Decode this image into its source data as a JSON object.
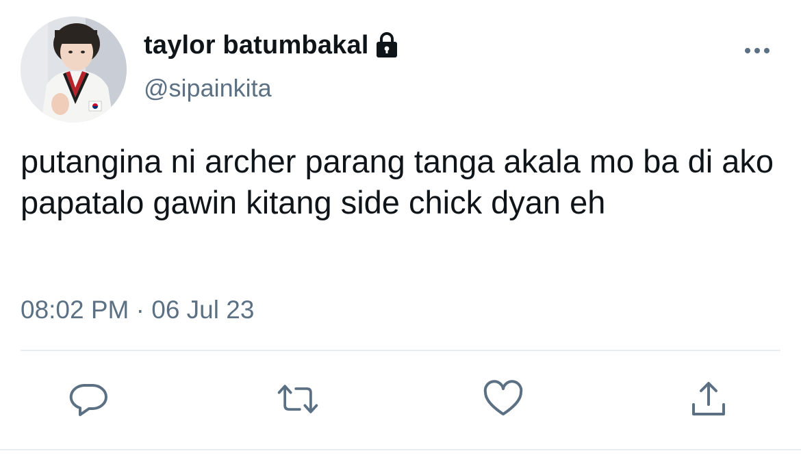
{
  "colors": {
    "text_primary": "#0f1419",
    "text_secondary": "#5b7083",
    "divider": "#e6ecf0",
    "icon": "#5b7083"
  },
  "author": {
    "display_name": "taylor batumbakal",
    "handle": "@sipainkita",
    "protected_icon": "lock-icon",
    "avatar_icon": "avatar"
  },
  "tweet": {
    "text": "putangina ni archer parang tanga akala mo ba di ako papatalo gawin kitang side chick dyan eh",
    "timestamp": "08:02 PM · 06 Jul 23"
  },
  "menu": {
    "icon": "more-icon"
  },
  "actions": [
    {
      "name": "reply",
      "icon": "reply-icon"
    },
    {
      "name": "retweet",
      "icon": "retweet-icon"
    },
    {
      "name": "like",
      "icon": "heart-icon"
    },
    {
      "name": "share",
      "icon": "share-icon"
    }
  ]
}
